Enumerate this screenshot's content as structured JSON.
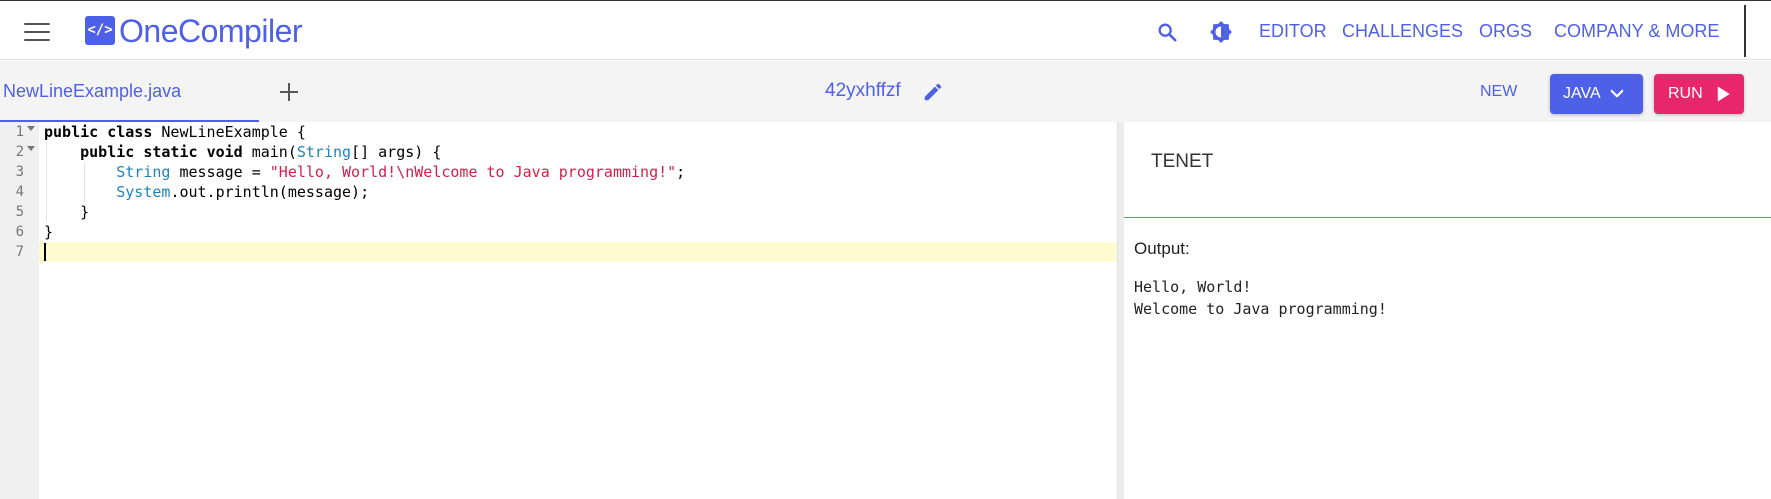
{
  "topbar": {
    "logo_glyph": "</>",
    "logo_text": "OneCompiler",
    "brand_color": "#4f60e8",
    "nav": {
      "editor": "EDITOR",
      "challenges": "CHALLENGES",
      "orgs": "ORGS",
      "company": "COMPANY & MORE"
    }
  },
  "toolbar": {
    "file_tab": "NewLineExample.java",
    "code_id": "42yxhffzf",
    "new_label": "NEW",
    "language_label": "JAVA",
    "run_label": "RUN",
    "run_color": "#e8276a"
  },
  "editor": {
    "lines": [
      {
        "num": "1",
        "text": "public class NewLineExample {"
      },
      {
        "num": "2",
        "text": "    public static void main(String[] args) {"
      },
      {
        "num": "3",
        "text": "        String message = \"Hello, World!\\nWelcome to Java programming!\";"
      },
      {
        "num": "4",
        "text": "        System.out.println(message);"
      },
      {
        "num": "5",
        "text": "    }"
      },
      {
        "num": "6",
        "text": "}"
      },
      {
        "num": "7",
        "text": ""
      }
    ],
    "active_line": "7",
    "tokens": {
      "public": "public",
      "class": "class",
      "class_name": " NewLineExample {",
      "static": "static",
      "void": "void",
      "main_open": " main(",
      "String": "String",
      "args": "[] args) {",
      "message_decl": " message = ",
      "string_literal": "\"Hello, World!\\nWelcome to Java programming!\"",
      "semicolon": ";",
      "System": "System",
      "println": ".out.println(message);",
      "close_inner": "}",
      "close_outer": "}"
    }
  },
  "stdin": {
    "text": "TENET"
  },
  "output": {
    "label": "Output:",
    "lines": [
      "Hello, World!",
      "Welcome to Java programming!"
    ]
  },
  "icons": {
    "menu": "hamburger-icon",
    "search": "search-icon",
    "theme": "theme-toggle-icon",
    "add": "plus-icon",
    "edit": "pencil-icon",
    "dropdown": "chevron-down-icon",
    "run": "play-icon"
  }
}
